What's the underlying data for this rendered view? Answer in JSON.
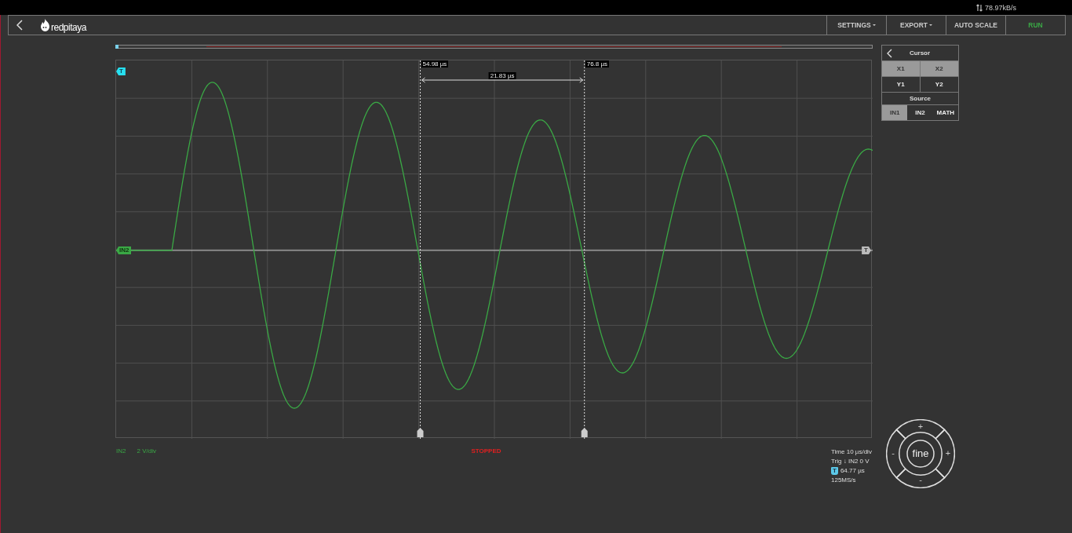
{
  "status_bar": {
    "network_rate": "78.97kB/s"
  },
  "nav": {
    "logo": "redpitaya",
    "buttons": [
      {
        "label": "SETTINGS",
        "kind": "menu"
      },
      {
        "label": "EXPORT",
        "kind": "menu"
      },
      {
        "label": "AUTO SCALE",
        "kind": "action"
      },
      {
        "label": "RUN",
        "kind": "run"
      }
    ]
  },
  "plot": {
    "trigger_marker": "T",
    "channel_marker": "IN2",
    "trigger_level_marker": "T",
    "cursors": [
      {
        "label": "54.98 µs",
        "level": 0.402
      },
      {
        "label": "76.8 µs",
        "level": 0.619
      }
    ],
    "cursor_delta": "21.83 µs"
  },
  "cursor_panel": {
    "title": "Cursor",
    "cursor_buttons": [
      {
        "label": "X1",
        "selected": true
      },
      {
        "label": "X2",
        "selected": true
      },
      {
        "label": "Y1",
        "selected": false
      },
      {
        "label": "Y2",
        "selected": false
      }
    ],
    "source_title": "Source",
    "sources": [
      {
        "label": "IN1",
        "selected": true
      },
      {
        "label": "IN2",
        "selected": false
      },
      {
        "label": "MATH",
        "selected": false
      }
    ]
  },
  "channel_info": {
    "channel": "IN2",
    "scale": "2 V/div"
  },
  "status": "STOPPED",
  "acquisition_info": {
    "time_scale": "Time 10 µs/div",
    "trigger": "Trig ↓ IN2 0 V",
    "trigger_marker": "T",
    "trigger_time": "64.77 µs",
    "sample_rate": "125MS/s"
  },
  "wheel": {
    "center": "fine",
    "top": "+",
    "left": "-",
    "right": "+",
    "bottom": "-"
  }
}
